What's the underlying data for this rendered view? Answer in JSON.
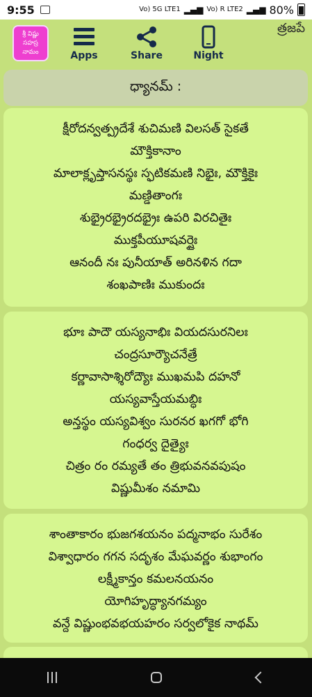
{
  "status_bar": {
    "time": "9:55",
    "signal1": "Vo) 5G\nLTE1",
    "signal2": "Vo) R\nLTE2",
    "battery": "80%"
  },
  "toolbar": {
    "logo_text": "శ్రీ విష్ణు సహస్ర నామం",
    "apps_label": "Apps",
    "share_label": "Share",
    "night_label": "Night",
    "edge_text": "త్రజపే"
  },
  "section_title": "ధ్యానమ్ :",
  "verses": [
    {
      "lines": [
        "క్షీరోదన్వత్ప్రదేశే శుచిమణి విలసత్ సైకతే",
        "మౌక్తికానాం",
        "మాలాక్లృప్తాసనస్థః స్ఫటికమణి నిభైః, మౌక్తికైః",
        "మణ్డితాంగః",
        "శుభ్రైరభ్రైరదభ్రైః ఉపరి విరచితైః",
        "ముక్తపీయూషవర్షైః",
        "ఆనందీ నః పునీయాత్ అరినళిన గదా",
        "శంఖపాణిః ముకుందః"
      ]
    },
    {
      "lines": [
        "భూః పాదౌ యస్యనాభిః వియదసురనిలః",
        "చంద్రసూర్యౌచనేత్రే",
        "కర్ణావాసాశ్శిరోద్యౌః ముఖమపి దహనో",
        "యస్యవాస్తేయమబ్ధిః",
        "అన్తస్థం యస్యవిశ్వం సురనర ఖగగో భోగి",
        "గంధర్వ దైత్యైః",
        "చిత్రం రం రమ్యతే తం త్రిభువనవపుషం",
        "విష్ణుమీశం నమామి"
      ]
    },
    {
      "lines": [
        "శాంతాకారం భుజగశయనం పద్మనాభం సురేశం",
        "విశ్వాధారం గగన సదృశం మేఘవర్ణం శుభాంగం",
        "లక్ష్మీకాన్తం కమలనయనం",
        "యోగిహృద్ధ్యానగమ్యం",
        "వన్దే విష్ణుంభవభయహరం సర్వలోకైక నాథమ్"
      ]
    }
  ],
  "colors": {
    "background": "#c4e07c",
    "card": "#d6f690",
    "title_bar": "#c9d3ab",
    "logo": "#ee3fd0",
    "icon": "#152a4a"
  }
}
